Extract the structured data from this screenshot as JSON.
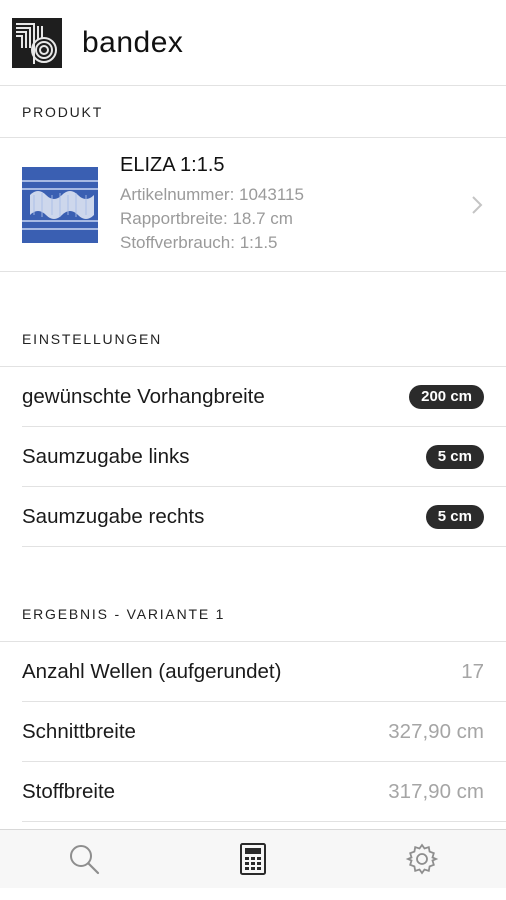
{
  "app": {
    "brand": "bandex"
  },
  "sections": {
    "product": "PRODUKT",
    "settings": "EINSTELLUNGEN",
    "result": "ERGEBNIS - VARIANTE 1"
  },
  "product": {
    "name": "ELIZA 1:1.5",
    "article": "Artikelnummer: 1043115",
    "repeat": "Rapportbreite: 18.7 cm",
    "usage": "Stoffverbrauch: 1:1.5"
  },
  "settings": [
    {
      "label": "gewünschte Vorhangbreite",
      "value": "200 cm"
    },
    {
      "label": "Saumzugabe links",
      "value": "5 cm"
    },
    {
      "label": "Saumzugabe rechts",
      "value": "5 cm"
    }
  ],
  "results": [
    {
      "label": "Anzahl Wellen (aufgerundet)",
      "value": "17"
    },
    {
      "label": "Schnittbreite",
      "value": "327,90 cm"
    },
    {
      "label": "Stoffbreite",
      "value": "317,90 cm"
    }
  ],
  "tabs": {
    "search": "search-icon",
    "calculator": "calculator-icon",
    "settings": "gear-icon"
  },
  "colors": {
    "pill": "#2b2b2b",
    "thumb": "#3a64b8",
    "muted": "#9a9a9a"
  }
}
